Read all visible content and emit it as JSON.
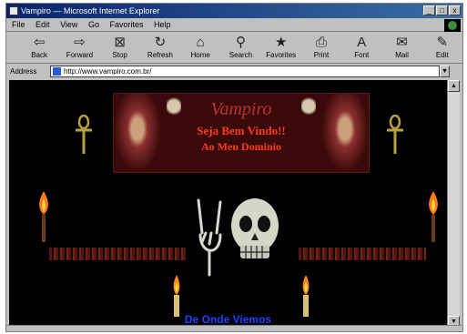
{
  "window": {
    "title": "Vampiro — Microsoft Internet Explorer",
    "controls": [
      "_",
      "□",
      "x"
    ]
  },
  "menu": [
    "File",
    "Edit",
    "View",
    "Go",
    "Favorites",
    "Help"
  ],
  "toolbar": [
    {
      "label": "Back",
      "icon": "back-arrow-icon",
      "glyph": "⇦"
    },
    {
      "label": "Forward",
      "icon": "forward-arrow-icon",
      "glyph": "⇨"
    },
    {
      "label": "Stop",
      "icon": "stop-icon",
      "glyph": "⊠"
    },
    {
      "label": "Refresh",
      "icon": "refresh-icon",
      "glyph": "↻"
    },
    {
      "label": "Home",
      "icon": "home-icon",
      "glyph": "⌂"
    },
    {
      "label": "Search",
      "icon": "search-icon",
      "glyph": "⚲"
    },
    {
      "label": "Favorites",
      "icon": "favorites-icon",
      "glyph": "★"
    },
    {
      "label": "Print",
      "icon": "print-icon",
      "glyph": "⎙"
    },
    {
      "label": "Font",
      "icon": "font-icon",
      "glyph": "A"
    },
    {
      "label": "Mail",
      "icon": "mail-icon",
      "glyph": "✉"
    },
    {
      "label": "Edit",
      "icon": "edit-icon",
      "glyph": "✎"
    }
  ],
  "address": {
    "label": "Address",
    "value": "http://www.vampiro.com.br/",
    "dropdown_glyph": "▼"
  },
  "banner": {
    "brand": "Vampiro",
    "welcome": "Seja Bem Vindo!!",
    "domain": "Ao Meu Dominio"
  },
  "content": {
    "link_text": "De Onde Viemos"
  },
  "colors": {
    "background": "#000000",
    "banner_text": "#ff3a1a",
    "link": "#2040ff",
    "gold": "#b8a040"
  },
  "scroll": {
    "up": "▲",
    "down": "▼"
  }
}
